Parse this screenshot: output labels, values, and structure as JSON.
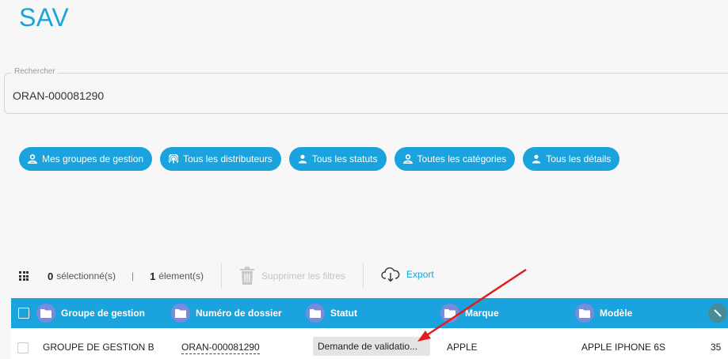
{
  "page": {
    "title": "SAV"
  },
  "search": {
    "label": "Rechercher",
    "value": "ORAN-000081290"
  },
  "filters": [
    {
      "label": "Mes groupes de gestion",
      "icon": "user-outline-icon"
    },
    {
      "label": "Tous les distributeurs",
      "icon": "signal-icon"
    },
    {
      "label": "Tous les statuts",
      "icon": "user-solid-icon"
    },
    {
      "label": "Toutes les catégories",
      "icon": "user-outline-icon"
    },
    {
      "label": "Tous les détails",
      "icon": "user-solid-icon"
    }
  ],
  "toolbar": {
    "selected_count": "0",
    "selected_label": "sélectionné(s)",
    "separator": "|",
    "element_count": "1",
    "element_label": "élement(s)",
    "clear_filters_label": "Supprimer les filtres",
    "export_label": "Export"
  },
  "table": {
    "headers": [
      "Groupe de gestion",
      "Numéro de dossier",
      "Statut",
      "Marque",
      "Modèle"
    ],
    "rows": [
      {
        "groupe": "GROUPE DE GESTION B",
        "numero": "ORAN-000081290",
        "statut": "Demande de validatio...",
        "marque": "APPLE",
        "modele": "APPLE IPHONE 6S",
        "extra": "35"
      }
    ]
  },
  "colors": {
    "accent": "#1aa3dc",
    "header_icon": "#7c8bd9",
    "annotation_arrow": "#e11d1d"
  }
}
